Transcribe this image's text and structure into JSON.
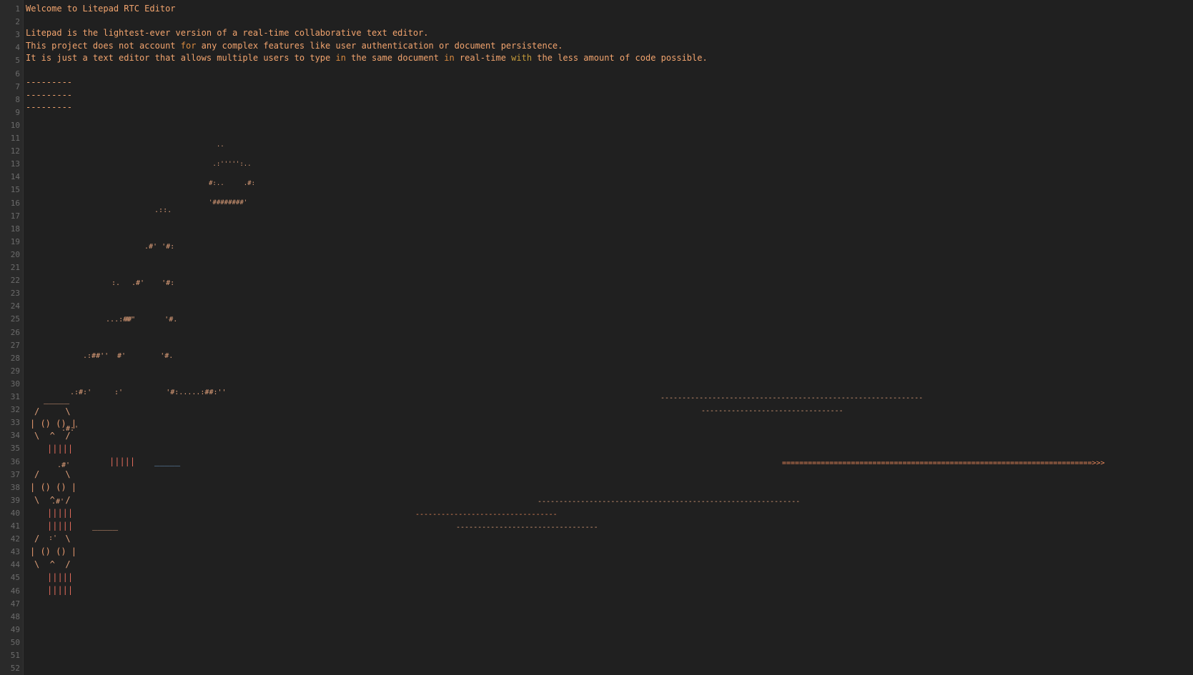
{
  "app": {
    "title": "Litepad RTC Editor"
  },
  "gutter": {
    "line_numbers": [
      "1",
      "2",
      "3",
      "4",
      "5",
      "6",
      "7",
      "8",
      "9",
      "10",
      "11",
      "12",
      "13",
      "14",
      "15",
      "16",
      "17",
      "18",
      "19",
      "20",
      "21",
      "22",
      "23",
      "24",
      "25",
      "26",
      "27",
      "28",
      "29",
      "30",
      "31",
      "32",
      "33",
      "34",
      "35",
      "36",
      "37",
      "38",
      "39",
      "40",
      "41",
      "42",
      "43",
      "44",
      "45",
      "46",
      "47",
      "48",
      "49",
      "50",
      "51",
      "52"
    ]
  },
  "text": {
    "line1": "Welcome to Litepad RTC Editor",
    "line3": "Litepad is the lightest-ever version of a real-time collaborative text editor.",
    "line4_a": "This project does not account ",
    "line4_for": "for",
    "line4_b": " any complex features like user authentication or document persistence.",
    "line5_a": "It is just a text editor that allows multiple users to type ",
    "line5_in1": "in",
    "line5_b": " the same document ",
    "line5_in2": "in",
    "line5_c": " real-time ",
    "line5_with": "with",
    "line5_d": " the less amount of code possible.",
    "line7": "---------",
    "line8": "---------",
    "line9": "---------"
  },
  "drawing": {
    "head_1": "  ..",
    "head_2": " .:''''':..",
    "head_3": "#:..     .#:",
    "head_4": "'########'",
    "arm_1": "  .::.",
    "arm_2": " .#' '#:",
    "arm_3": ".#'    '#:",
    "arm_4": "#'       '#.",
    "arm_5": "#'        '#.",
    "arm_6": ":'          '#:.....:##:''",
    "tail_1": ":.",
    "tail_2": "  ...:##'",
    "tail_3": " .:##''",
    "tail_4": ".:#:'",
    "tail_5": ".#:'",
    "tail_6": ".#'",
    "tail_7": ".#'",
    "tail_8": ":'"
  },
  "robots": {
    "top_cap": "_____",
    "brow": "/     \\",
    "eyes": "| () () |",
    "mouth": "\\  ^  /",
    "teeth": "|||||",
    "stray_bars": "|||||",
    "underline": "_____"
  },
  "dashes": {
    "d31": "-------------------------------------------------------------",
    "d32": "---------------------------------",
    "d36_arrow": "========================================================================>>>",
    "d39": "-------------------------------------------------------------",
    "d40": "---------------------------------",
    "d41": "---------------------------------"
  },
  "colors": {
    "background": "#202020",
    "gutter": "#2a2a2a",
    "text": "#f2a46e",
    "keyword": "#d98a3f",
    "line_number": "#6b6b6b"
  }
}
